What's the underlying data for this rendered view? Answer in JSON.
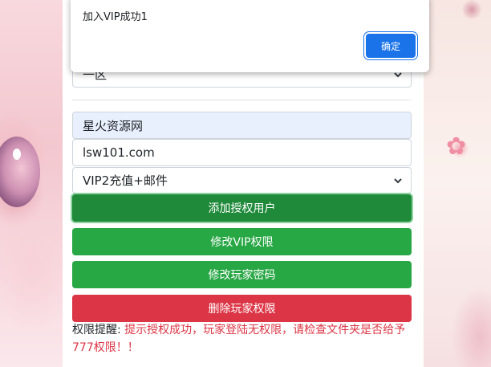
{
  "form": {
    "server_select": "一区",
    "site_name": "星火资源网",
    "site_url": "lsw101.com",
    "vip_select": "VIP2充值+邮件"
  },
  "buttons": {
    "add_auth_user": "添加授权用户",
    "modify_vip": "修改VIP权限",
    "modify_password": "修改玩家密码",
    "delete_permission": "删除玩家权限"
  },
  "notice": {
    "label": "权限提醒:",
    "message": "提示授权成功，玩家登陆无权限，请检查文件夹是否给予777权限！！"
  },
  "dialog": {
    "message": "加入VIP成功1",
    "ok_label": "确定"
  },
  "colors": {
    "primary_green": "#28a745",
    "focused_green": "#1f8a3a",
    "danger_red": "#dc3545",
    "dialog_blue": "#1a73e8"
  }
}
